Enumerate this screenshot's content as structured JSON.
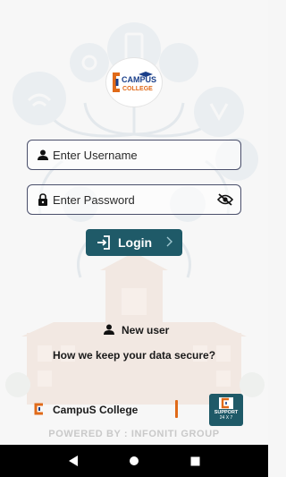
{
  "logo": {
    "line1": "CAMPUS",
    "line2": "COLLEGE"
  },
  "username": {
    "placeholder": "Enter Username",
    "value": ""
  },
  "password": {
    "placeholder": "Enter Password",
    "value": ""
  },
  "login": {
    "label": "Login"
  },
  "new_user": {
    "label": "New user"
  },
  "secure_link": {
    "label": "How we keep your data secure?"
  },
  "brand": {
    "name": "CampuS College"
  },
  "support": {
    "line1": "SUPPORT",
    "line2": "24 X 7"
  },
  "footer": {
    "powered_by": "POWERED BY : INFONITI GROUP"
  },
  "colors": {
    "primary": "#1f5a68",
    "accent": "#e06a19",
    "field_border": "#4a4f6b",
    "brand_blue": "#1a3f8a"
  },
  "icons": [
    "user-icon",
    "lock-icon",
    "eye-off-icon",
    "login-icon",
    "chevron-right-icon",
    "add-user-icon",
    "back-icon",
    "home-icon",
    "recents-icon"
  ]
}
